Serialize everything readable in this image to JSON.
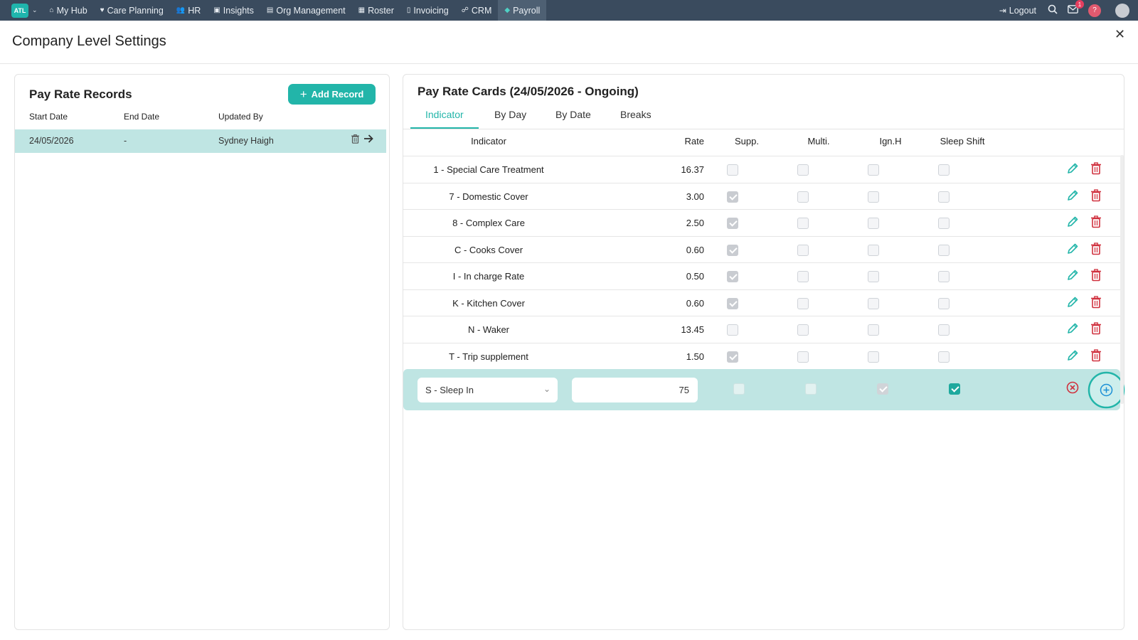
{
  "nav": {
    "brand": "ATL",
    "items": [
      {
        "label": "My Hub",
        "icon": "home-icon",
        "glyph": "⌂"
      },
      {
        "label": "Care Planning",
        "icon": "heart-icon",
        "glyph": "♥"
      },
      {
        "label": "HR",
        "icon": "people-icon",
        "glyph": "👥"
      },
      {
        "label": "Insights",
        "icon": "chart-icon",
        "glyph": "▣"
      },
      {
        "label": "Org Management",
        "icon": "building-icon",
        "glyph": "▤"
      },
      {
        "label": "Roster",
        "icon": "calendar-icon",
        "glyph": "▦"
      },
      {
        "label": "Invoicing",
        "icon": "document-icon",
        "glyph": "▯"
      },
      {
        "label": "CRM",
        "icon": "contacts-icon",
        "glyph": "☍"
      },
      {
        "label": "Payroll",
        "icon": "diamond-icon",
        "glyph": "◆"
      }
    ],
    "logout": "Logout",
    "mail_badge": "1",
    "help": "?"
  },
  "page": {
    "title": "Company Level Settings"
  },
  "records": {
    "title": "Pay Rate Records",
    "add_button": "Add Record",
    "columns": [
      "Start Date",
      "End Date",
      "Updated By"
    ],
    "rows": [
      {
        "start": "24/05/2026",
        "end": "-",
        "updated_by": "Sydney Haigh"
      }
    ]
  },
  "cards": {
    "title": "Pay Rate Cards (24/05/2026 - Ongoing)",
    "tabs": [
      "Indicator",
      "By Day",
      "By Date",
      "Breaks"
    ],
    "active_tab": "Indicator",
    "columns": [
      "Indicator",
      "Rate",
      "Supp.",
      "Multi.",
      "Ign.H",
      "Sleep Shift"
    ],
    "rows": [
      {
        "indicator": "1 - Special Care Treatment",
        "rate": "16.37",
        "supp": false,
        "multi": false,
        "ignh": false,
        "sleep": false
      },
      {
        "indicator": "7 - Domestic Cover",
        "rate": "3.00",
        "supp": true,
        "multi": false,
        "ignh": false,
        "sleep": false
      },
      {
        "indicator": "8 - Complex Care",
        "rate": "2.50",
        "supp": true,
        "multi": false,
        "ignh": false,
        "sleep": false
      },
      {
        "indicator": "C - Cooks Cover",
        "rate": "0.60",
        "supp": true,
        "multi": false,
        "ignh": false,
        "sleep": false
      },
      {
        "indicator": "I - In charge Rate",
        "rate": "0.50",
        "supp": true,
        "multi": false,
        "ignh": false,
        "sleep": false
      },
      {
        "indicator": "K - Kitchen Cover",
        "rate": "0.60",
        "supp": true,
        "multi": false,
        "ignh": false,
        "sleep": false
      },
      {
        "indicator": "N - Waker",
        "rate": "13.45",
        "supp": false,
        "multi": false,
        "ignh": false,
        "sleep": false
      },
      {
        "indicator": "T - Trip supplement",
        "rate": "1.50",
        "supp": true,
        "multi": false,
        "ignh": false,
        "sleep": false
      }
    ],
    "new_row": {
      "indicator": "S - Sleep In",
      "rate": "75",
      "supp": false,
      "multi": false,
      "ignh": true,
      "sleep": true
    }
  },
  "colors": {
    "accent": "#22b5a9",
    "danger": "#d0313e",
    "nav_bg": "#3a4b5e",
    "highlight_row": "#bfe5e3"
  }
}
